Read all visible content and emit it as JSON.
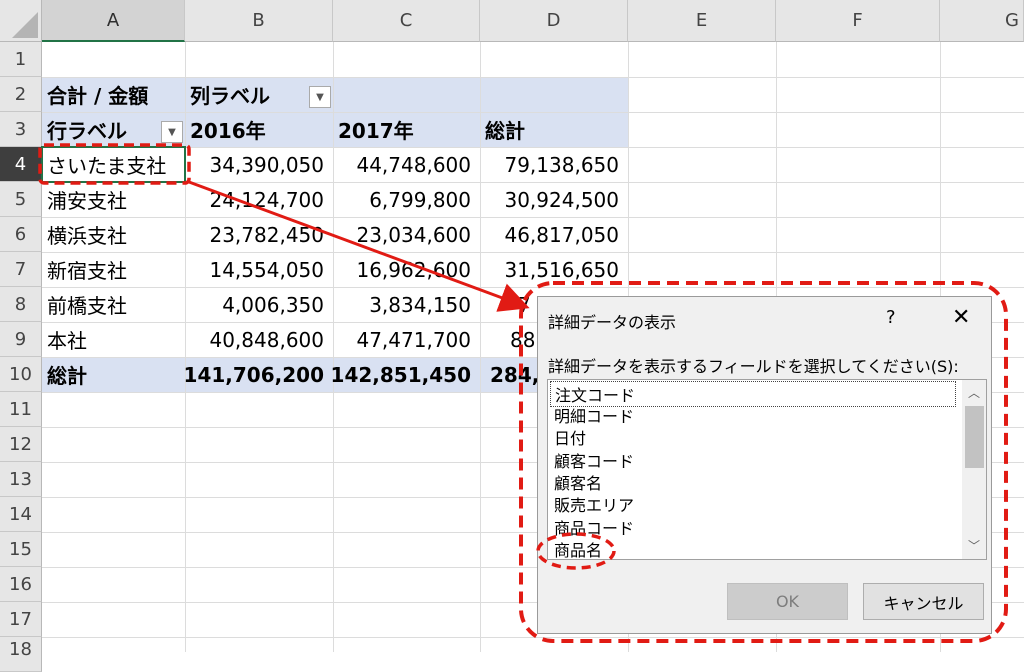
{
  "columns": [
    "A",
    "B",
    "C",
    "D",
    "E",
    "F",
    "G"
  ],
  "rows": [
    "1",
    "2",
    "3",
    "4",
    "5",
    "6",
    "7",
    "8",
    "9",
    "10",
    "11",
    "12",
    "13",
    "14",
    "15",
    "16",
    "17",
    "18"
  ],
  "pivot": {
    "header_row2": {
      "a": "合計 / 金額",
      "b": "列ラベル"
    },
    "header_row3": {
      "a": "行ラベル",
      "b": "2016年",
      "c": "2017年",
      "d": "総計"
    },
    "data_rows": [
      {
        "label": "さいたま支社",
        "y2016": "34,390,050",
        "y2017": "44,748,600",
        "total": "79,138,650"
      },
      {
        "label": "浦安支社",
        "y2016": "24,124,700",
        "y2017": "6,799,800",
        "total": "30,924,500"
      },
      {
        "label": "横浜支社",
        "y2016": "23,782,450",
        "y2017": "23,034,600",
        "total": "46,817,050"
      },
      {
        "label": "新宿支社",
        "y2016": "14,554,050",
        "y2017": "16,962,600",
        "total": "31,516,650"
      },
      {
        "label": "前橋支社",
        "y2016": "4,006,350",
        "y2017": "3,834,150",
        "total": "7"
      },
      {
        "label": "本社",
        "y2016": "40,848,600",
        "y2017": "47,471,700",
        "total": "88"
      }
    ],
    "grand_total": {
      "label": "総計",
      "y2016": "141,706,200",
      "y2017": "142,851,450",
      "total": "284,"
    }
  },
  "dialog": {
    "title": "詳細データの表示",
    "help": "?",
    "close": "✕",
    "prompt": "詳細データを表示するフィールドを選択してください(S):",
    "fields": [
      "注文コード",
      "明細コード",
      "日付",
      "顧客コード",
      "顧客名",
      "販売エリア",
      "商品コード",
      "商品名"
    ],
    "ok_label": "OK",
    "cancel_label": "キャンセル"
  },
  "colors": {
    "pivot_band": "#d9e1f2",
    "annotation_red": "#e11b14",
    "selected_col_line": "#217346"
  }
}
